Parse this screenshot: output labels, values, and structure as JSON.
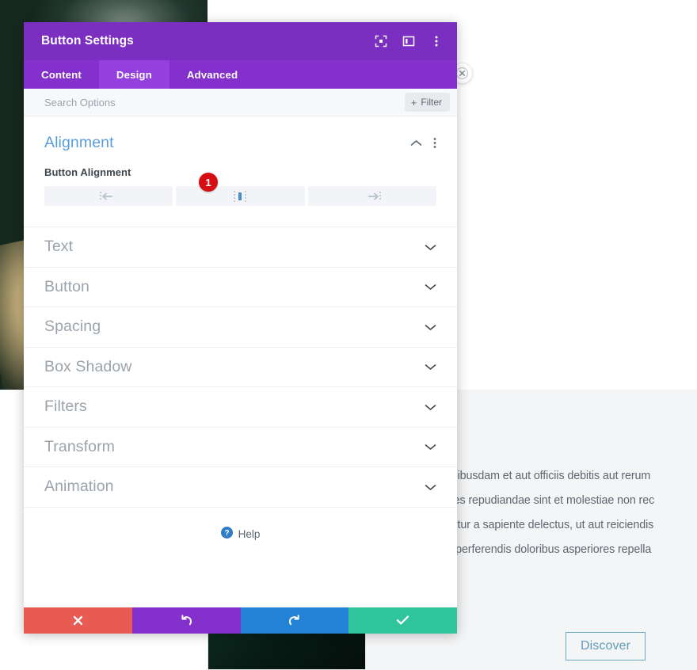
{
  "background": {
    "paragraph_lines": [
      "us autem quibusdam et aut officiis debitis aut rerum",
      "t et voluptates repudiandae sint et molestiae non rec",
      "rum hic tenetur a sapiente delectus, ut aut reiciendis",
      "equatur aut perferendis doloribus asperiores repella"
    ],
    "discover_label": "Discover"
  },
  "modal": {
    "title": "Button Settings",
    "header_icons": [
      {
        "name": "focus-target-icon"
      },
      {
        "name": "layout-panel-icon"
      },
      {
        "name": "more-vertical-icon"
      }
    ],
    "tabs": [
      {
        "label": "Content",
        "active": false
      },
      {
        "label": "Design",
        "active": true
      },
      {
        "label": "Advanced",
        "active": false
      }
    ],
    "search": {
      "placeholder": "Search Options",
      "value": "",
      "filter_label": "Filter",
      "filter_plus": "+"
    },
    "open_section": {
      "title": "Alignment",
      "field_label": "Button Alignment",
      "badge": "1",
      "options": [
        {
          "name": "align-left",
          "label": "Left",
          "selected": false
        },
        {
          "name": "align-center",
          "label": "Center",
          "selected": true
        },
        {
          "name": "align-right",
          "label": "Right",
          "selected": false
        }
      ]
    },
    "collapsed_sections": [
      {
        "label": "Text"
      },
      {
        "label": "Button"
      },
      {
        "label": "Spacing"
      },
      {
        "label": "Box Shadow"
      },
      {
        "label": "Filters"
      },
      {
        "label": "Transform"
      },
      {
        "label": "Animation"
      }
    ],
    "help_label": "Help",
    "footer_buttons": [
      {
        "name": "cancel-button",
        "icon": "close-icon",
        "color": "#e85a52"
      },
      {
        "name": "undo-button",
        "icon": "undo-icon",
        "color": "#8430cd"
      },
      {
        "name": "redo-button",
        "icon": "redo-icon",
        "color": "#2283d6"
      },
      {
        "name": "save-button",
        "icon": "checkmark-icon",
        "color": "#2fc49b"
      }
    ]
  },
  "colors": {
    "header_purple": "#7b2fc0",
    "tabbar_purple": "#8430cd",
    "tab_active_purple": "#9340df",
    "section_title_blue": "#5b9dd9",
    "badge_red": "#d60d12"
  }
}
